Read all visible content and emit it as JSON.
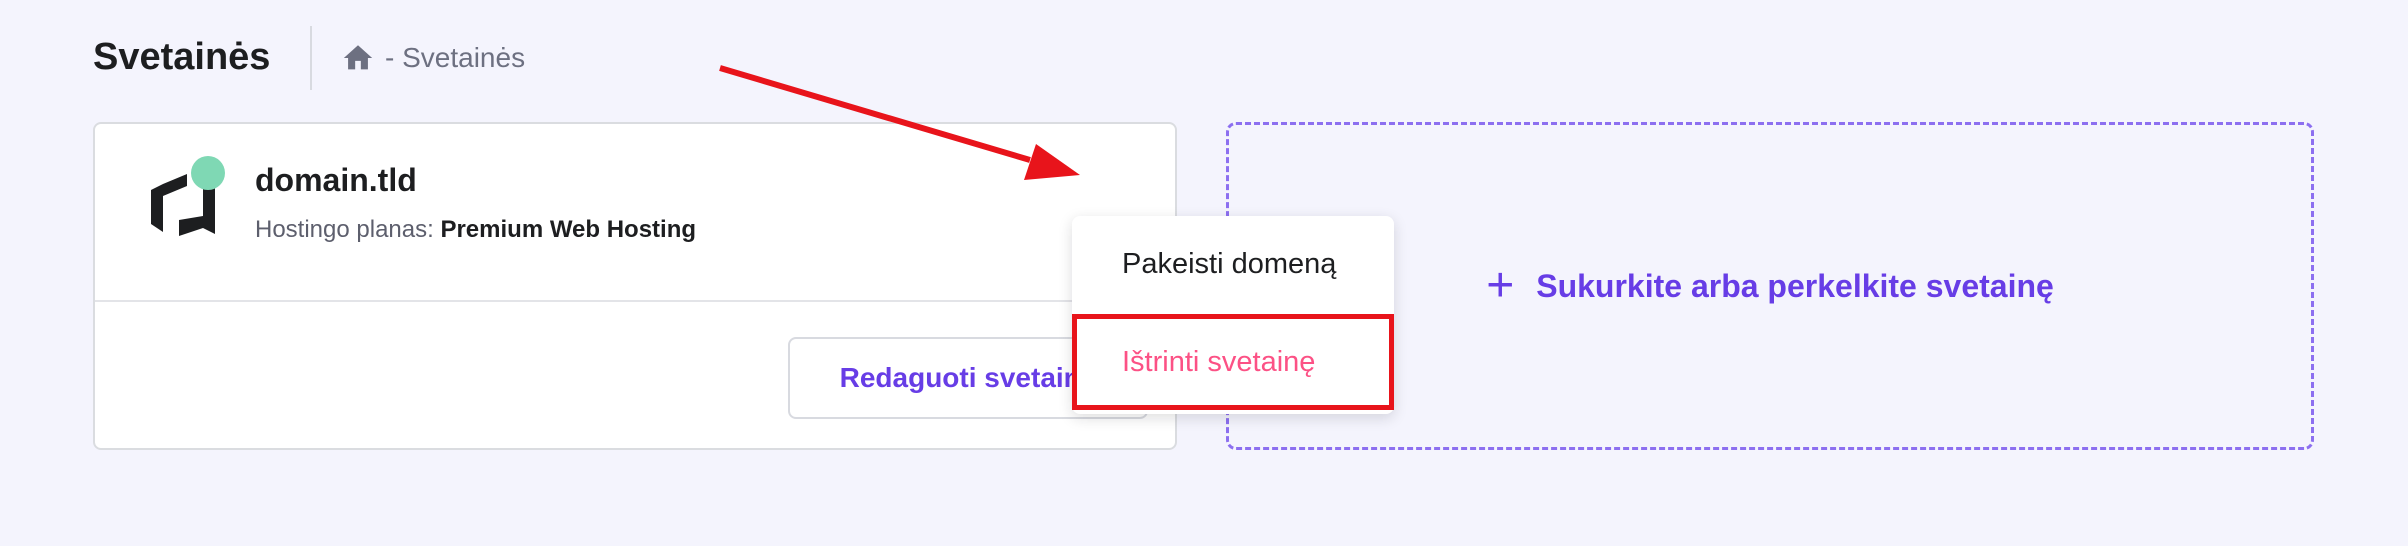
{
  "header": {
    "title": "Svetainės",
    "breadcrumb": "- Svetainės"
  },
  "site": {
    "domain": "domain.tld",
    "plan_label": "Hostingo planas:",
    "plan_value": "Premium Web Hosting",
    "edit_label": "Redaguoti svetainę"
  },
  "menu": {
    "items": [
      "Pakeisti domeną",
      "Ištrinti svetainę"
    ]
  },
  "create": {
    "label": "Sukurkite arba perkelkite svetainę"
  },
  "colors": {
    "accent": "#673de6",
    "danger": "#fc5185",
    "highlight": "#e8141b",
    "status": "#7fd8b4"
  },
  "icons": {
    "home": "home-icon",
    "more": "more-options-icon",
    "plus": "plus-icon",
    "logo": "hostinger-logo"
  }
}
